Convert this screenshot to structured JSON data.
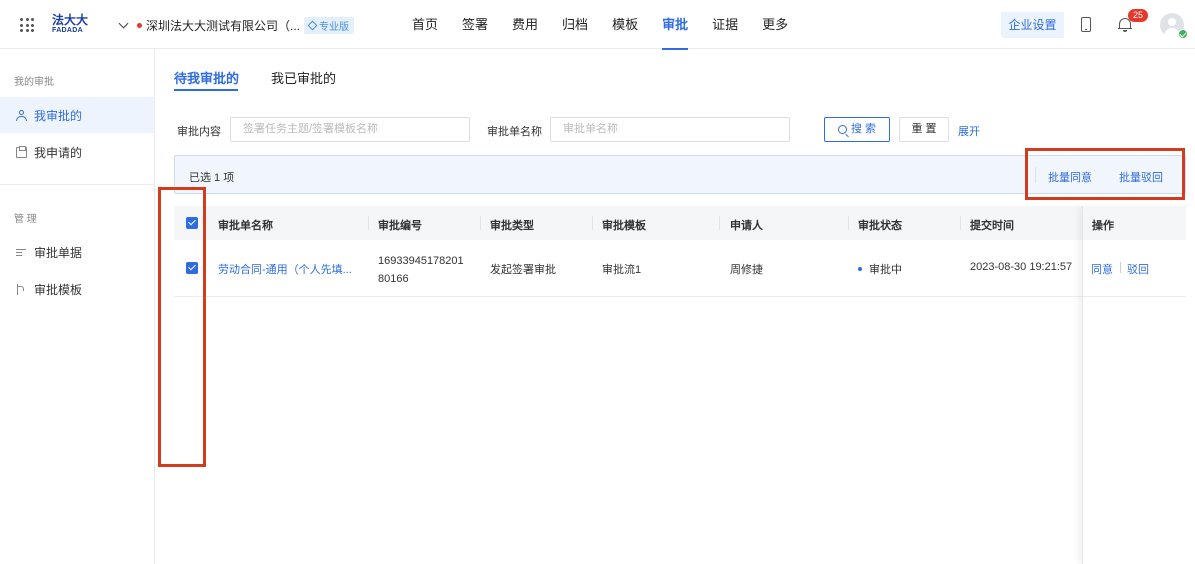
{
  "brand": {
    "cn": "法大大",
    "en": "FADADA"
  },
  "header": {
    "company_name": "深圳法大大测试有限公司（...",
    "edition_badge": "专业版",
    "nav": [
      "首页",
      "签署",
      "费用",
      "归档",
      "模板",
      "审批",
      "证据",
      "更多"
    ],
    "active_nav": "审批",
    "enterprise_settings": "企业设置",
    "notification_count": "25"
  },
  "sidebar": {
    "section_my": "我的审批",
    "item_my_approve": "我审批的",
    "item_my_apply": "我申请的",
    "section_manage": "管 理",
    "item_forms": "审批单据",
    "item_templates": "审批模板"
  },
  "tabs": {
    "pending": "待我审批的",
    "done": "我已审批的"
  },
  "filters": {
    "content_label": "审批内容",
    "content_placeholder": "签署任务主题/签署模板名称",
    "form_label": "审批单名称",
    "form_placeholder": "审批单名称",
    "search_btn": "搜 索",
    "reset_btn": "重 置",
    "expand_link": "展开"
  },
  "selection": {
    "text": "已选 1 项",
    "batch_approve": "批量同意",
    "batch_reject": "批量驳回"
  },
  "table": {
    "headers": [
      "审批单名称",
      "审批编号",
      "审批类型",
      "审批模板",
      "申请人",
      "审批状态",
      "提交时间",
      "操作"
    ],
    "rows": [
      {
        "name": "劳动合同-通用（个人先填...",
        "number_line1": "16933945178201",
        "number_line2": "80166",
        "type": "发起签署审批",
        "template": "审批流1",
        "applicant": "周修捷",
        "status": "审批中",
        "submit_time": "2023-08-30 19:21:57",
        "op_approve": "同意",
        "op_reject": "驳回"
      }
    ]
  },
  "colors": {
    "accent": "#2f6cdf",
    "annotation": "#d23b1e"
  }
}
